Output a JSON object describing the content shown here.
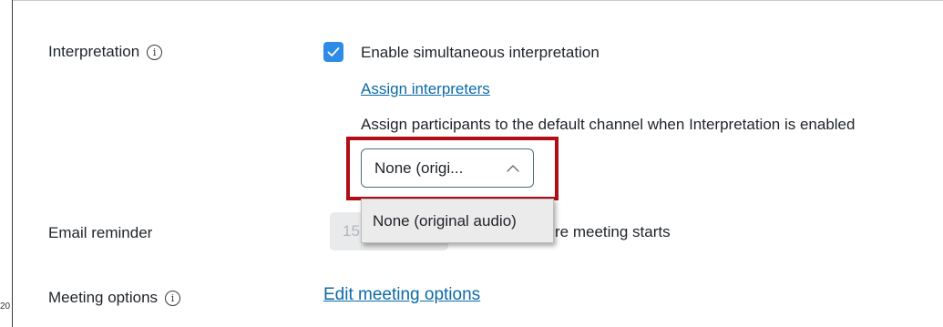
{
  "page_number": "20",
  "interpretation": {
    "label": "Interpretation",
    "info_icon": "info-circle-icon",
    "checkbox_checked": true,
    "checkbox_label": "Enable simultaneous interpretation",
    "assign_link": "Assign interpreters",
    "default_channel_text": "Assign participants to the default channel when Interpretation is enabled",
    "select_value": "None (origi...",
    "dropdown_option": "None (original audio)"
  },
  "email_reminder": {
    "label": "Email reminder",
    "value": "15",
    "suffix": "re meeting starts"
  },
  "meeting_options": {
    "label": "Meeting options",
    "info_icon": "info-circle-icon",
    "edit_link": "Edit meeting options"
  },
  "colors": {
    "accent": "#2f8ce6",
    "link": "#0b6aa8",
    "highlight_border": "#b00d16"
  }
}
